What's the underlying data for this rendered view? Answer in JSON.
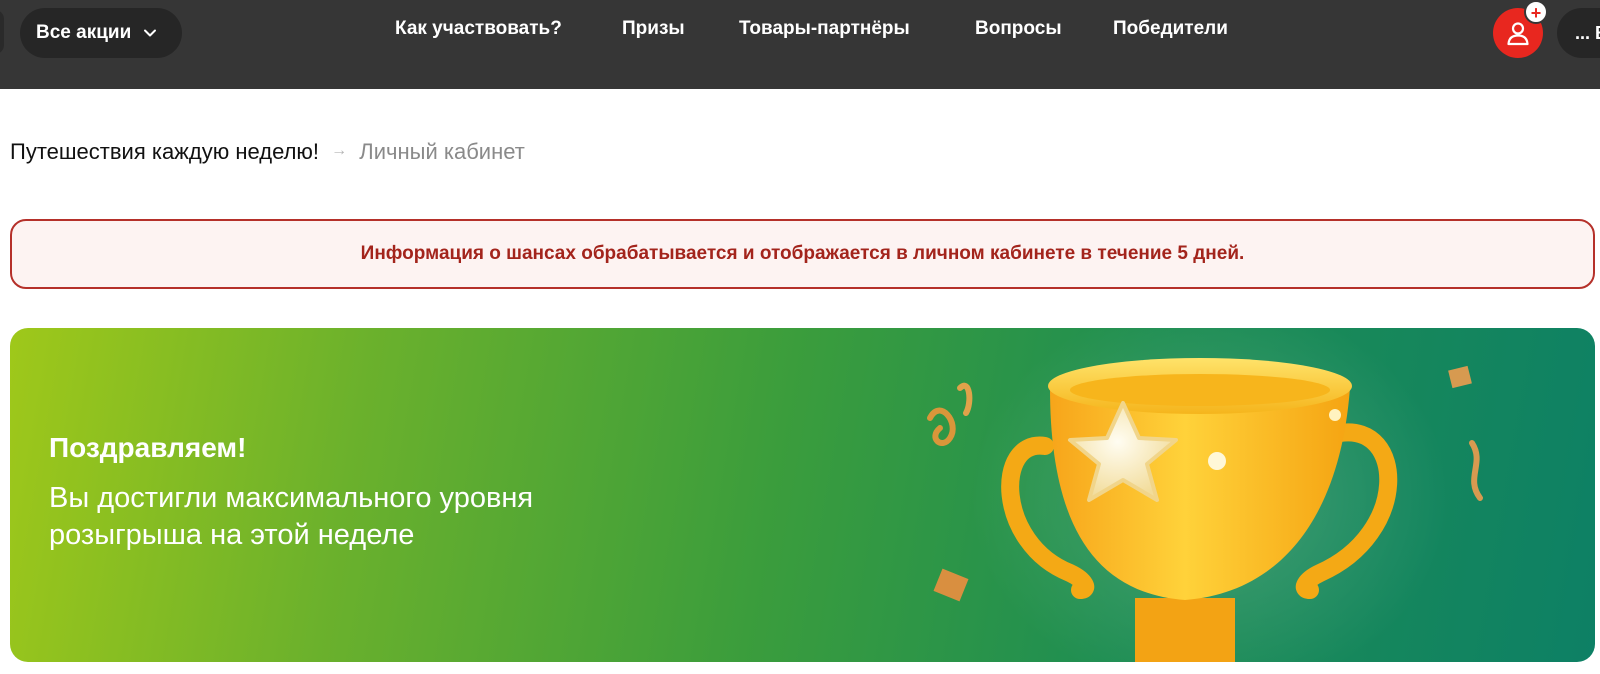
{
  "header": {
    "all_promos_label": "Все акции",
    "nav": [
      {
        "label": "Как участвовать?"
      },
      {
        "label": "Призы"
      },
      {
        "label": "Товары-партнёры"
      },
      {
        "label": "Вопросы"
      },
      {
        "label": "Победители"
      }
    ],
    "user_badge": "+",
    "right_pill_label": "... В"
  },
  "breadcrumb": {
    "parent": "Путешествия каждую неделю!",
    "separator": "→",
    "current": "Личный кабинет"
  },
  "notice": {
    "text": "Информация о шансах обрабатывается и отображается в личном кабинете в течение 5 дней."
  },
  "banner": {
    "title": "Поздравляем!",
    "subtitle": "Вы достигли максимального уровня розыгрыша на этой неделе"
  },
  "colors": {
    "header_bg": "#363636",
    "accent_red": "#e8271f",
    "notice_text": "#a3241c",
    "banner_start": "#9fc81a",
    "banner_end": "#0d8065"
  },
  "icons": [
    "chevron-down-icon",
    "user-icon",
    "plus-icon",
    "trophy-icon",
    "star-icon",
    "confetti-icon"
  ]
}
